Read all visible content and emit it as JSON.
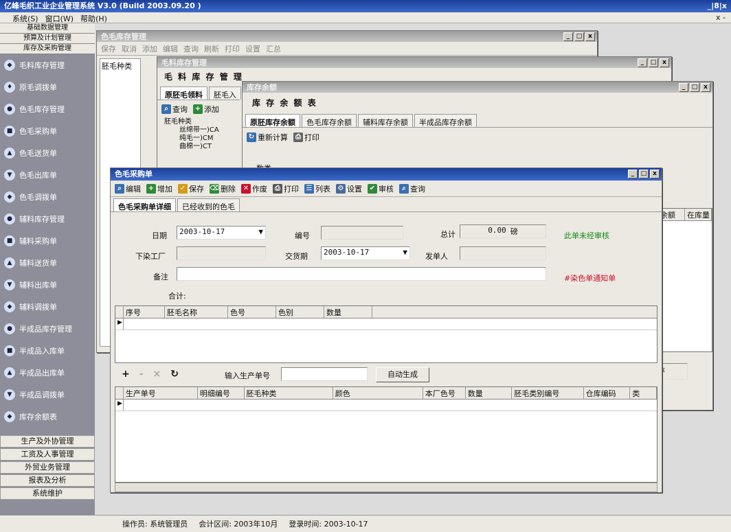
{
  "app": {
    "title": "亿峰毛织工业企业管理系统 V3.0 (Build 2003.09.20 )",
    "menu": [
      "系统(S)",
      "窗口(W)",
      "帮助(H)"
    ],
    "right_controls": "_|8|x",
    "second_row_right": "x -"
  },
  "sidebar": {
    "top": [
      "基础数据管理",
      "预算及计划管理",
      "库存及采购管理"
    ],
    "items": [
      "毛料库存管理",
      "原毛调拨单",
      "色毛库存管理",
      "色毛采购单",
      "色毛送货单",
      "色毛出库单",
      "色毛调拨单",
      "辅料库存管理",
      "辅料采购单",
      "辅料送货单",
      "辅料出库单",
      "辅料调拨单",
      "半成品库存管理",
      "半成品入库单",
      "半成品出库单",
      "半成品调拨单",
      "库存余额表"
    ],
    "bottom": [
      "生产及外协管理",
      "工资及人事管理",
      "外贸业务管理",
      "报表及分析",
      "系统维护"
    ]
  },
  "win1": {
    "title": "色毛库存管理",
    "toolbar": [
      "保存",
      "取消",
      "添加",
      "编辑",
      "查询",
      "刷新",
      "打印",
      "设置",
      "汇总"
    ],
    "left": "胚毛种类"
  },
  "win2": {
    "title": "毛料库存管理",
    "header": "毛 料 库 存 管 理",
    "tabs": [
      "原胚毛领料",
      "胚毛入"
    ],
    "toolbar": [
      "查询",
      "添加"
    ],
    "tree": {
      "root": "胚毛种类",
      "children": [
        "丝绵带一)CA",
        "纯毛一)CM",
        "曲棉一)CT",
        "一)"
      ]
    }
  },
  "win3": {
    "title": "库存余额",
    "header": "库 存 余 额 表",
    "tabs": [
      "原胚库存余额",
      "色毛库存余额",
      "辅料库存余额",
      "半成品库存余额"
    ],
    "toolbar": [
      "重新计算",
      "打印"
    ],
    "filter": "数类",
    "right_cols": [
      "余额",
      "在库量"
    ],
    "partial_btn": "存"
  },
  "main": {
    "title": "色毛采购单",
    "toolbar": [
      "编辑",
      "增加",
      "保存",
      "删除",
      "作废",
      "打印",
      "列表",
      "设置",
      "审核",
      "查询"
    ],
    "tabs": [
      "色毛采购单详细",
      "已经收到的色毛"
    ],
    "form": {
      "date_label": "日期",
      "date_value": "2003-10-17",
      "number_label": "编号",
      "number_value": "",
      "total_label": "总计",
      "total_value": "0.00",
      "total_unit": "磅",
      "status": "此单未经审核",
      "factory_label": "下染工厂",
      "factory_value": "",
      "delivery_label": "交货期",
      "delivery_value": "2003-10-17",
      "sender_label": "发单人",
      "sender_value": "",
      "remark_label": "备注",
      "remark_value": "",
      "notice": "#染色单通知单",
      "sum_label": "合计:"
    },
    "grid1": {
      "columns": [
        "序号",
        "胚毛名称",
        "色号",
        "色别",
        "数量"
      ]
    },
    "action_icons": [
      "+",
      "-",
      "×",
      "↻"
    ],
    "prod_input_label": "输入生产单号",
    "prod_input_value": "",
    "auto_btn": "自动生成",
    "grid2": {
      "columns": [
        "生产单号",
        "明细编号",
        "胚毛种类",
        "颜色",
        "本厂色号",
        "数量",
        "胚毛类别编号",
        "仓库编码",
        "类"
      ]
    }
  },
  "status": {
    "operator": "操作员: 系统管理员",
    "period": "会计区间: 2003年10月",
    "login": "登录时间: 2003-10-17"
  },
  "colors": {
    "title_blue": "#1a3f9a",
    "sidebar": "#8e8e9a",
    "notice_red": "#c8102e",
    "status_green": "#138a13"
  }
}
